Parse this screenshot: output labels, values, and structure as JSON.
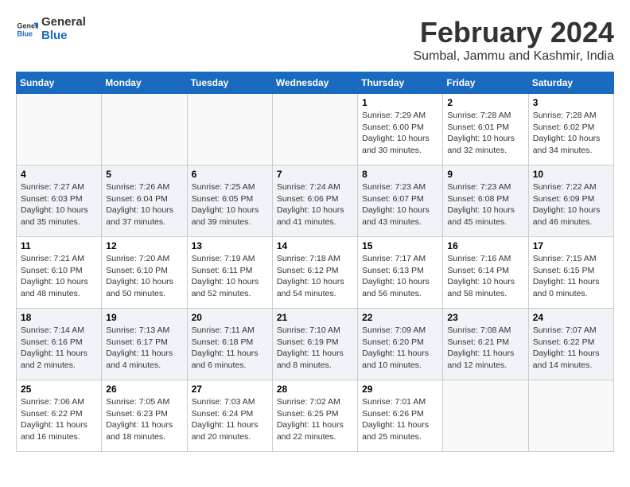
{
  "header": {
    "logo_line1": "General",
    "logo_line2": "Blue",
    "month_title": "February 2024",
    "location": "Sumbal, Jammu and Kashmir, India"
  },
  "weekdays": [
    "Sunday",
    "Monday",
    "Tuesday",
    "Wednesday",
    "Thursday",
    "Friday",
    "Saturday"
  ],
  "weeks": [
    [
      {
        "day": "",
        "detail": ""
      },
      {
        "day": "",
        "detail": ""
      },
      {
        "day": "",
        "detail": ""
      },
      {
        "day": "",
        "detail": ""
      },
      {
        "day": "1",
        "detail": "Sunrise: 7:29 AM\nSunset: 6:00 PM\nDaylight: 10 hours\nand 30 minutes."
      },
      {
        "day": "2",
        "detail": "Sunrise: 7:28 AM\nSunset: 6:01 PM\nDaylight: 10 hours\nand 32 minutes."
      },
      {
        "day": "3",
        "detail": "Sunrise: 7:28 AM\nSunset: 6:02 PM\nDaylight: 10 hours\nand 34 minutes."
      }
    ],
    [
      {
        "day": "4",
        "detail": "Sunrise: 7:27 AM\nSunset: 6:03 PM\nDaylight: 10 hours\nand 35 minutes."
      },
      {
        "day": "5",
        "detail": "Sunrise: 7:26 AM\nSunset: 6:04 PM\nDaylight: 10 hours\nand 37 minutes."
      },
      {
        "day": "6",
        "detail": "Sunrise: 7:25 AM\nSunset: 6:05 PM\nDaylight: 10 hours\nand 39 minutes."
      },
      {
        "day": "7",
        "detail": "Sunrise: 7:24 AM\nSunset: 6:06 PM\nDaylight: 10 hours\nand 41 minutes."
      },
      {
        "day": "8",
        "detail": "Sunrise: 7:23 AM\nSunset: 6:07 PM\nDaylight: 10 hours\nand 43 minutes."
      },
      {
        "day": "9",
        "detail": "Sunrise: 7:23 AM\nSunset: 6:08 PM\nDaylight: 10 hours\nand 45 minutes."
      },
      {
        "day": "10",
        "detail": "Sunrise: 7:22 AM\nSunset: 6:09 PM\nDaylight: 10 hours\nand 46 minutes."
      }
    ],
    [
      {
        "day": "11",
        "detail": "Sunrise: 7:21 AM\nSunset: 6:10 PM\nDaylight: 10 hours\nand 48 minutes."
      },
      {
        "day": "12",
        "detail": "Sunrise: 7:20 AM\nSunset: 6:10 PM\nDaylight: 10 hours\nand 50 minutes."
      },
      {
        "day": "13",
        "detail": "Sunrise: 7:19 AM\nSunset: 6:11 PM\nDaylight: 10 hours\nand 52 minutes."
      },
      {
        "day": "14",
        "detail": "Sunrise: 7:18 AM\nSunset: 6:12 PM\nDaylight: 10 hours\nand 54 minutes."
      },
      {
        "day": "15",
        "detail": "Sunrise: 7:17 AM\nSunset: 6:13 PM\nDaylight: 10 hours\nand 56 minutes."
      },
      {
        "day": "16",
        "detail": "Sunrise: 7:16 AM\nSunset: 6:14 PM\nDaylight: 10 hours\nand 58 minutes."
      },
      {
        "day": "17",
        "detail": "Sunrise: 7:15 AM\nSunset: 6:15 PM\nDaylight: 11 hours\nand 0 minutes."
      }
    ],
    [
      {
        "day": "18",
        "detail": "Sunrise: 7:14 AM\nSunset: 6:16 PM\nDaylight: 11 hours\nand 2 minutes."
      },
      {
        "day": "19",
        "detail": "Sunrise: 7:13 AM\nSunset: 6:17 PM\nDaylight: 11 hours\nand 4 minutes."
      },
      {
        "day": "20",
        "detail": "Sunrise: 7:11 AM\nSunset: 6:18 PM\nDaylight: 11 hours\nand 6 minutes."
      },
      {
        "day": "21",
        "detail": "Sunrise: 7:10 AM\nSunset: 6:19 PM\nDaylight: 11 hours\nand 8 minutes."
      },
      {
        "day": "22",
        "detail": "Sunrise: 7:09 AM\nSunset: 6:20 PM\nDaylight: 11 hours\nand 10 minutes."
      },
      {
        "day": "23",
        "detail": "Sunrise: 7:08 AM\nSunset: 6:21 PM\nDaylight: 11 hours\nand 12 minutes."
      },
      {
        "day": "24",
        "detail": "Sunrise: 7:07 AM\nSunset: 6:22 PM\nDaylight: 11 hours\nand 14 minutes."
      }
    ],
    [
      {
        "day": "25",
        "detail": "Sunrise: 7:06 AM\nSunset: 6:22 PM\nDaylight: 11 hours\nand 16 minutes."
      },
      {
        "day": "26",
        "detail": "Sunrise: 7:05 AM\nSunset: 6:23 PM\nDaylight: 11 hours\nand 18 minutes."
      },
      {
        "day": "27",
        "detail": "Sunrise: 7:03 AM\nSunset: 6:24 PM\nDaylight: 11 hours\nand 20 minutes."
      },
      {
        "day": "28",
        "detail": "Sunrise: 7:02 AM\nSunset: 6:25 PM\nDaylight: 11 hours\nand 22 minutes."
      },
      {
        "day": "29",
        "detail": "Sunrise: 7:01 AM\nSunset: 6:26 PM\nDaylight: 11 hours\nand 25 minutes."
      },
      {
        "day": "",
        "detail": ""
      },
      {
        "day": "",
        "detail": ""
      }
    ]
  ]
}
